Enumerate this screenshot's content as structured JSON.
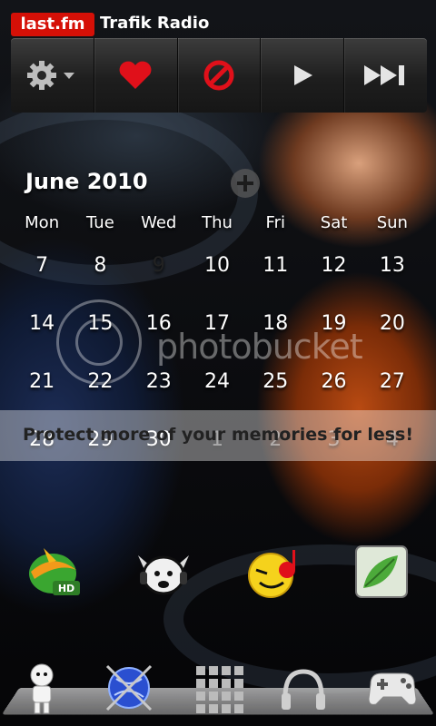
{
  "header": {
    "logo_text": "last.fm",
    "station_title": "Trafik Radio"
  },
  "toolbar": {
    "buttons": [
      {
        "icon": "gear-dropdown-icon"
      },
      {
        "icon": "heart-icon",
        "color": "#e0101a"
      },
      {
        "icon": "ban-icon",
        "color": "#e0101a"
      },
      {
        "icon": "play-icon"
      },
      {
        "icon": "skip-forward-icon"
      }
    ]
  },
  "calendar": {
    "title": "June 2010",
    "weekdays": [
      "Mon",
      "Tue",
      "Wed",
      "Thu",
      "Fri",
      "Sat",
      "Sun"
    ],
    "weeks": [
      [
        "7",
        "8",
        "9",
        "10",
        "11",
        "12",
        "13"
      ],
      [
        "14",
        "15",
        "16",
        "17",
        "18",
        "19",
        "20"
      ],
      [
        "21",
        "22",
        "23",
        "24",
        "25",
        "26",
        "27"
      ],
      [
        "28",
        "29",
        "30",
        "1",
        "2",
        "3",
        "4"
      ]
    ],
    "today": "9"
  },
  "watermark": {
    "text": "photobucket",
    "banner": "Protect more of your memories for less!"
  },
  "apps": [
    {
      "icon": "hd-app-icon"
    },
    {
      "icon": "viking-headphones-app-icon"
    },
    {
      "icon": "smiley-music-app-icon"
    },
    {
      "icon": "leaf-app-icon"
    }
  ],
  "dock": [
    {
      "icon": "android-robot-icon"
    },
    {
      "icon": "globe-icon"
    },
    {
      "icon": "app-drawer-icon"
    },
    {
      "icon": "headphones-icon"
    },
    {
      "icon": "game-controller-icon"
    }
  ],
  "colors": {
    "lastfm_red": "#d51007",
    "accent_red": "#e0101a"
  }
}
